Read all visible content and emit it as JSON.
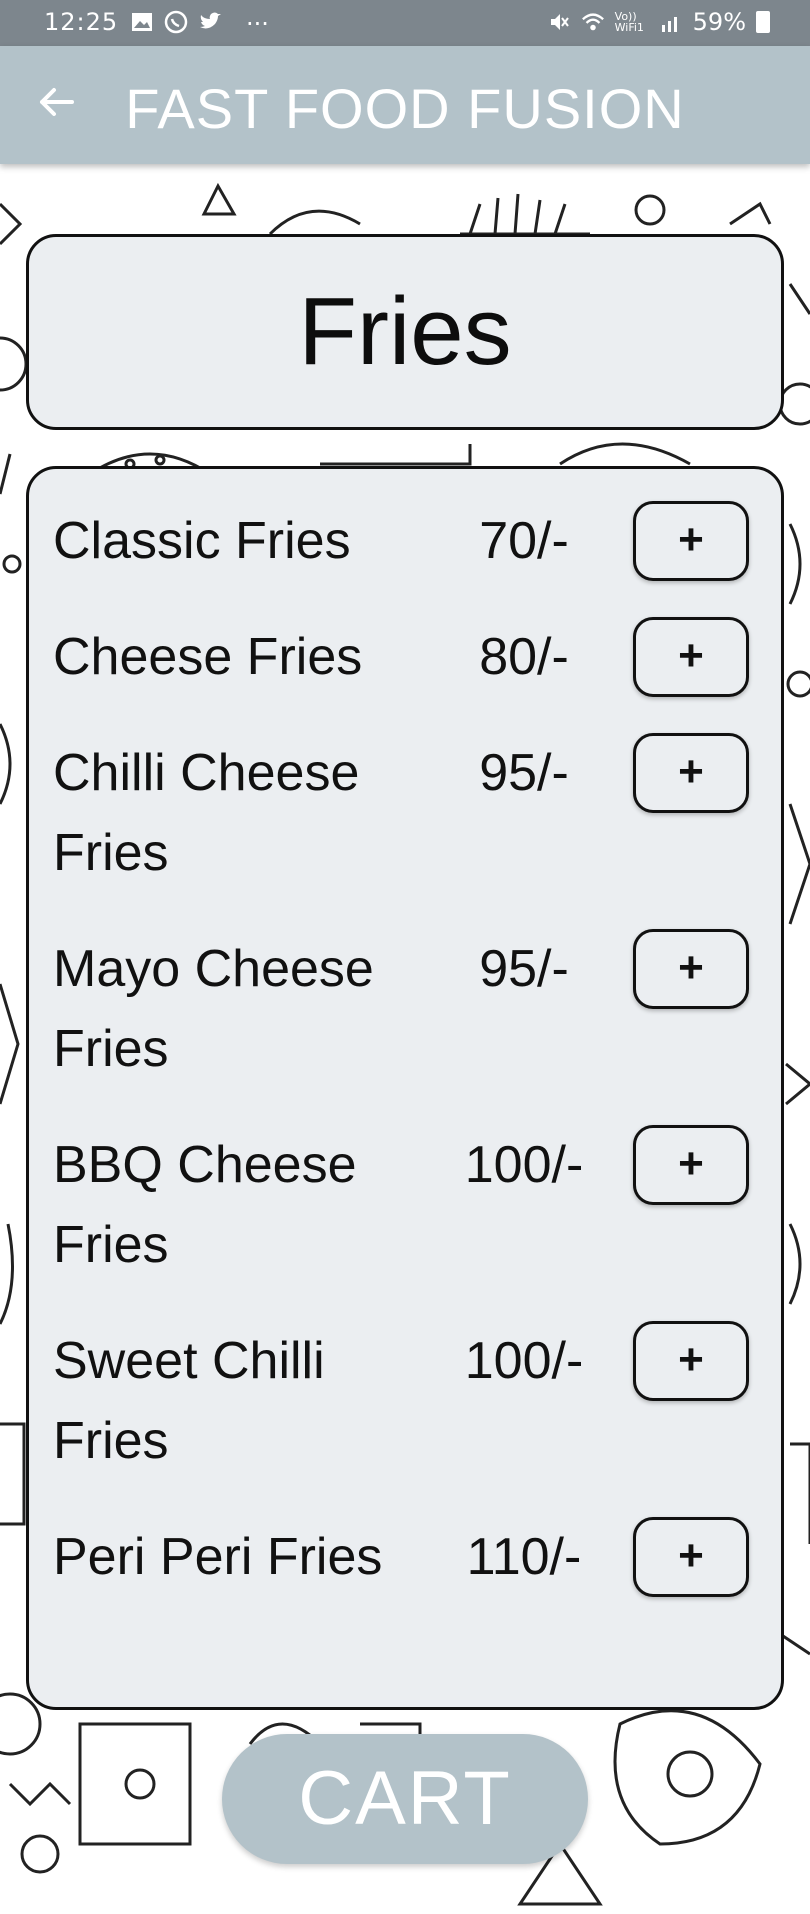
{
  "status_bar": {
    "time": "12:25",
    "dots": "···",
    "network_label": "Vo)) WiFi1",
    "battery": "59%",
    "icons": [
      "image-icon",
      "whatsapp-icon",
      "twitter-icon",
      "mute-icon",
      "wifi-icon",
      "signal-icon",
      "battery-icon"
    ]
  },
  "app_bar": {
    "title": "FAST FOOD FUSION",
    "back_icon": "arrow-left-icon"
  },
  "category": {
    "title": "Fries"
  },
  "menu": {
    "items": [
      {
        "name": "Classic Fries",
        "price": "70/-",
        "add_label": "+"
      },
      {
        "name": "Cheese Fries",
        "price": "80/-",
        "add_label": "+"
      },
      {
        "name": "Chilli Cheese Fries",
        "price": "95/-",
        "add_label": "+"
      },
      {
        "name": "Mayo Cheese Fries",
        "price": "95/-",
        "add_label": "+"
      },
      {
        "name": "BBQ Cheese Fries",
        "price": "100/-",
        "add_label": "+"
      },
      {
        "name": "Sweet Chilli Fries",
        "price": "100/-",
        "add_label": "+"
      },
      {
        "name": "Peri Peri Fries",
        "price": "110/-",
        "add_label": "+"
      }
    ]
  },
  "cart": {
    "label": "CART"
  },
  "colors": {
    "app_bar": "#b3c2c9",
    "status_bar": "#7d868d",
    "card_bg": "#ebeef1",
    "border": "#111111"
  }
}
